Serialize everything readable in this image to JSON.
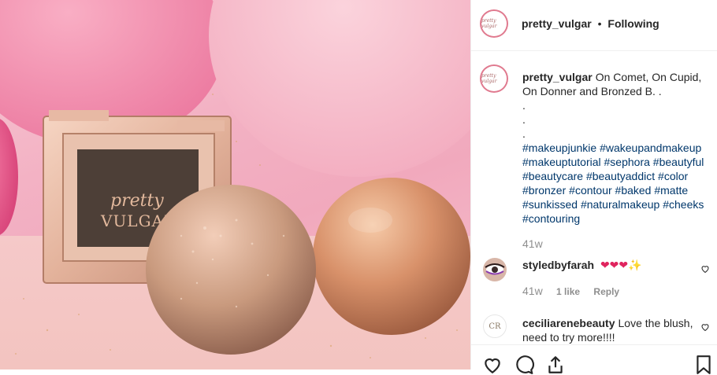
{
  "header": {
    "username": "pretty_vulgar",
    "separator": "•",
    "follow_state": "Following"
  },
  "brand": {
    "avatar_text": "pretty vulgar",
    "product_text_1": "pretty",
    "product_text_2": "VULGAR"
  },
  "caption": {
    "username": "pretty_vulgar",
    "text": "On Comet, On Cupid, On Donner and Bronzed B. .",
    "dots": [
      ".",
      ".",
      "."
    ],
    "hashtags": [
      "#makeupjunkie",
      "#wakeupandmakeup",
      "#makeuptutorial",
      "#sephora",
      "#beautyful",
      "#beautycare",
      "#beautyaddict",
      "#color",
      "#bronzer",
      "#contour",
      "#baked",
      "#matte",
      "#sunkissed",
      "#naturalmakeup",
      "#cheeks",
      "#contouring"
    ],
    "time": "41w"
  },
  "comments": [
    {
      "username": "styledbyfarah",
      "text": "",
      "time": "41w",
      "likes": "1 like",
      "reply": "Reply"
    },
    {
      "username": "ceciliarenebeauty",
      "text": "Love the blush, need to try more!!!!",
      "avatar_text": "CR"
    }
  ],
  "colors": {
    "link": "#00376b",
    "muted": "#8e8e8e",
    "heart_red": "#e0245e"
  }
}
